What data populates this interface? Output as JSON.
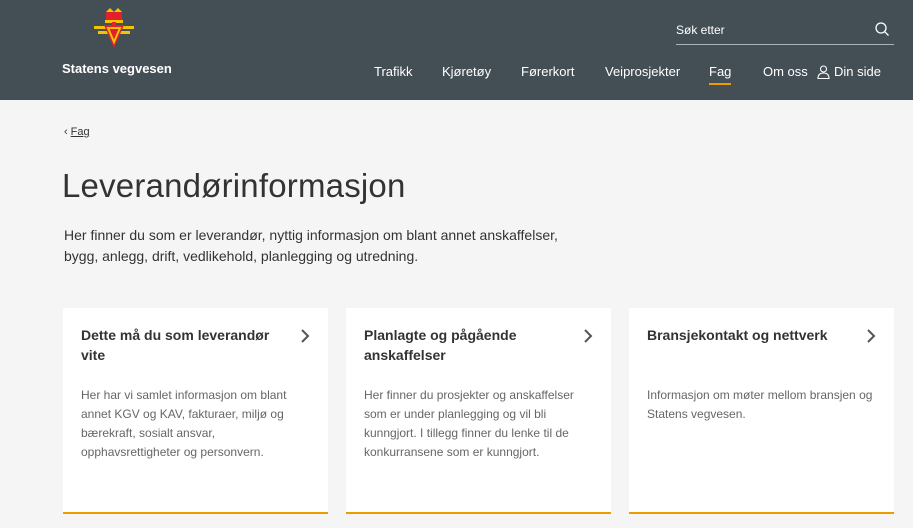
{
  "brand": {
    "name": "Statens vegvesen"
  },
  "search": {
    "placeholder": "Søk etter"
  },
  "nav": {
    "items": [
      {
        "label": "Trafikk"
      },
      {
        "label": "Kjøretøy"
      },
      {
        "label": "Førerkort"
      },
      {
        "label": "Veiprosjekter"
      },
      {
        "label": "Fag"
      },
      {
        "label": "Om oss"
      }
    ],
    "user_label": "Din side",
    "active": "Fag"
  },
  "breadcrumb": {
    "label": "Fag"
  },
  "page": {
    "title": "Leverandørinformasjon",
    "intro": "Her finner du som er leverandør, nyttig informasjon om blant annet anskaffelser, bygg, anlegg, drift, vedlikehold, planlegging og utredning."
  },
  "cards": [
    {
      "title": "Dette må du som leverandør vite",
      "desc": "Her har vi samlet informasjon om blant annet KGV og KAV, fakturaer, miljø og bærekraft, sosialt ansvar, opphavsrettigheter og personvern."
    },
    {
      "title": "Planlagte og pågående anskaffelser",
      "desc": "Her finner du prosjekter og anskaffelser som er under planlegging og vil bli kunngjort. I tillegg finner du lenke til de konkurransene som er kunngjort."
    },
    {
      "title": "Bransjekontakt og nettverk",
      "desc": "Informasjon om møter mellom bransjen og Statens vegvesen."
    }
  ],
  "colors": {
    "header_bg": "#444f55",
    "accent": "#ed9c00",
    "page_bg": "#f5f5f5",
    "card_bg": "#ffffff"
  },
  "icons": {
    "logo": "crown-shield-logo",
    "search": "search-icon",
    "user": "user-icon",
    "card_arrow": "chevron-right-icon",
    "breadcrumb": "chevron-left-icon"
  }
}
